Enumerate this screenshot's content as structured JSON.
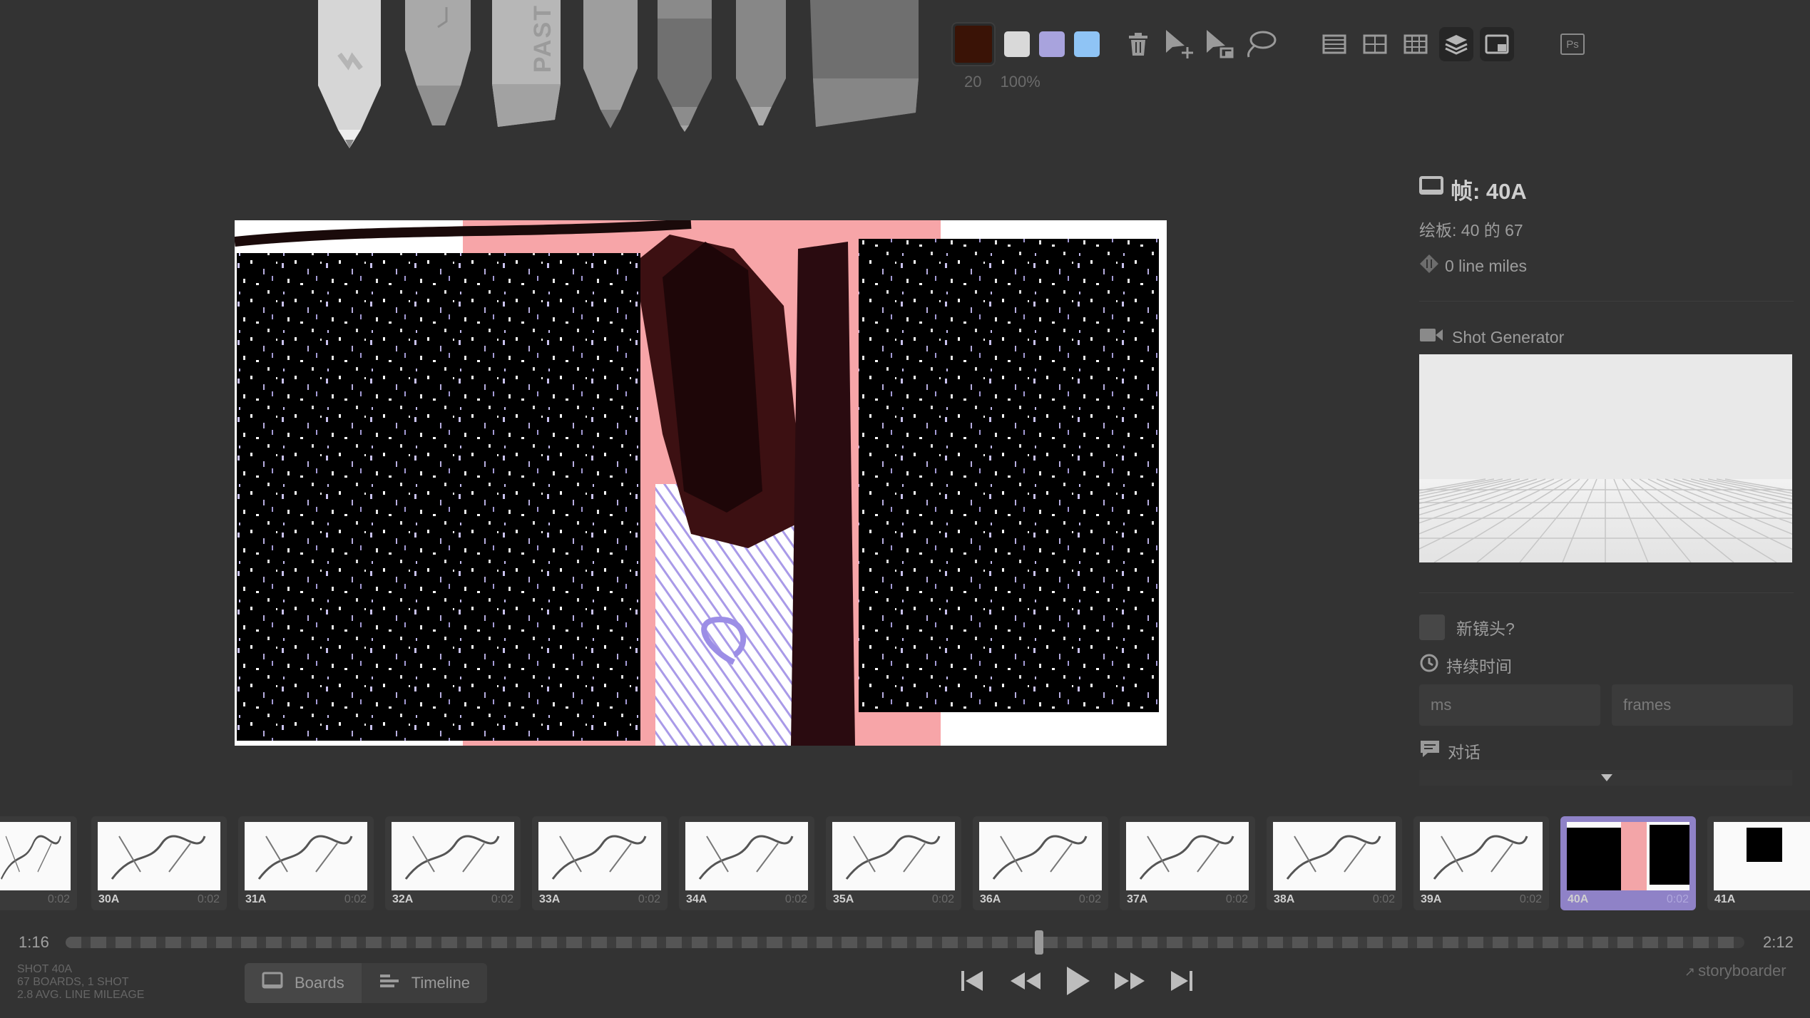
{
  "toolbar": {
    "tools": [
      "light-pencil",
      "brush-pen",
      "pastel",
      "pencil",
      "pen",
      "marker",
      "eraser"
    ],
    "pastel_label": "PAST",
    "colors": {
      "current": "#3a1306",
      "palette": [
        "#d9d9d9",
        "#a8a3dd",
        "#8fc4f5"
      ]
    },
    "brush_size": "20",
    "brush_opacity": "100%",
    "actions": [
      "trash-icon",
      "move-icon",
      "scale-icon",
      "lasso-icon"
    ],
    "grid_buttons": [
      "grid-halves-icon",
      "grid-quarters-icon",
      "grid-thirds-icon",
      "layers-icon",
      "onion-skin-icon"
    ],
    "ps_label": "Ps"
  },
  "panel": {
    "frame_title": "帧: 40A",
    "board_position": "绘板: 40 的 67",
    "line_miles": "0 line miles",
    "shot_generator": "Shot Generator",
    "new_shot_label": "新镜头?",
    "duration_label": "持续时间",
    "duration_ms_placeholder": "ms",
    "duration_frames_placeholder": "frames",
    "dialogue_label": "对话"
  },
  "thumbnails": [
    {
      "label": "",
      "duration": "0:02"
    },
    {
      "label": "30A",
      "duration": "0:02"
    },
    {
      "label": "31A",
      "duration": "0:02"
    },
    {
      "label": "32A",
      "duration": "0:02"
    },
    {
      "label": "33A",
      "duration": "0:02"
    },
    {
      "label": "34A",
      "duration": "0:02"
    },
    {
      "label": "35A",
      "duration": "0:02"
    },
    {
      "label": "36A",
      "duration": "0:02"
    },
    {
      "label": "37A",
      "duration": "0:02"
    },
    {
      "label": "38A",
      "duration": "0:02"
    },
    {
      "label": "39A",
      "duration": "0:02"
    },
    {
      "label": "40A",
      "duration": "0:02",
      "active": true
    },
    {
      "label": "41A",
      "duration": ""
    }
  ],
  "timeline": {
    "start": "1:16",
    "end": "2:12",
    "position": 0.58
  },
  "footer": {
    "shot": "SHOT 40A",
    "counts": "67 BOARDS, 1 SHOT",
    "mileage": "2.8 AVG. LINE MILEAGE",
    "boards_tab": "Boards",
    "timeline_tab": "Timeline",
    "brand": "storyboarder"
  }
}
